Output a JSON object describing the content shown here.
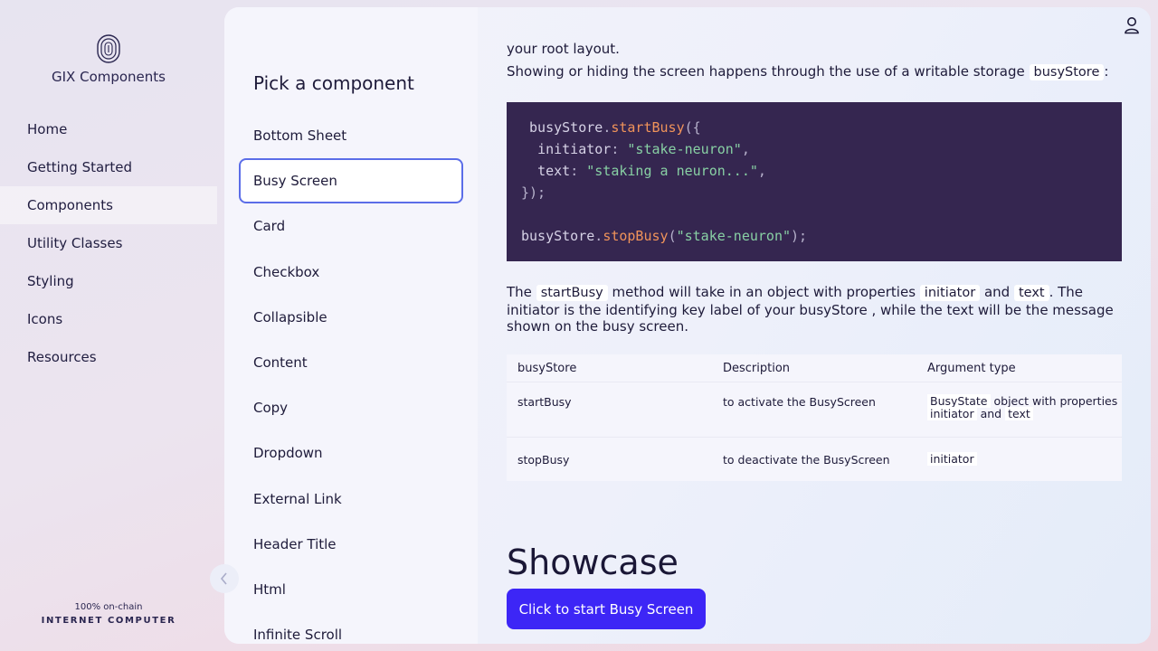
{
  "app": {
    "title": "GIX Components",
    "footer_small": "100% on-chain",
    "footer_big": "INTERNET COMPUTER"
  },
  "nav": {
    "items": [
      {
        "label": "Home"
      },
      {
        "label": "Getting Started"
      },
      {
        "label": "Components",
        "active": true
      },
      {
        "label": "Utility Classes"
      },
      {
        "label": "Styling"
      },
      {
        "label": "Icons"
      },
      {
        "label": "Resources"
      }
    ]
  },
  "picker": {
    "title": "Pick a component",
    "items": [
      "Bottom Sheet",
      "Busy Screen",
      "Card",
      "Checkbox",
      "Collapsible",
      "Content",
      "Copy",
      "Dropdown",
      "External Link",
      "Header Title",
      "Html",
      "Infinite Scroll"
    ],
    "selected": "Busy Screen"
  },
  "content": {
    "intro_tail": "your root layout.",
    "storage_text": "Showing or hiding the screen happens through the use of a writable storage",
    "storage_code": "busyStore",
    "storage_colon": ":",
    "code": {
      "l1_obj": "busyStore",
      "l1_dot": ".",
      "l1_fn": "startBusy",
      "l1_open": "({",
      "l2_key": "initiator",
      "l2_colon": ": ",
      "l2_val": "\"stake-neuron\"",
      "l2_comma": ",",
      "l3_key": "text",
      "l3_colon": ": ",
      "l3_val": "\"staking a neuron...\"",
      "l3_comma": ",",
      "l4": "});",
      "l6_obj": "busyStore",
      "l6_dot": ".",
      "l6_fn": "stopBusy",
      "l6_open": "(",
      "l6_val": "\"stake-neuron\"",
      "l6_close": ");"
    },
    "p3": {
      "the": "The",
      "code1": "startBusy",
      "mid1": "method will take in an object with properties",
      "code2": "initiator",
      "and": "and",
      "code3": "text",
      "rest": ". The initiator is the identifying key label of your busyStore , while the text will be the message shown on the busy screen."
    },
    "table": {
      "headers": [
        "busyStore",
        "Description",
        "Argument type"
      ],
      "rows": [
        {
          "name": "startBusy",
          "desc": "to activate the BusyScreen",
          "arg_code": "BusyState",
          "arg_text": "object with properties",
          "arg_code2": "initiator",
          "arg_and": "and",
          "arg_code3": "text"
        },
        {
          "name": "stopBusy",
          "desc": "to deactivate the BusyScreen",
          "arg_code": "initiator"
        }
      ]
    },
    "showcase_title": "Showcase",
    "button_label": "Click to start Busy Screen"
  }
}
